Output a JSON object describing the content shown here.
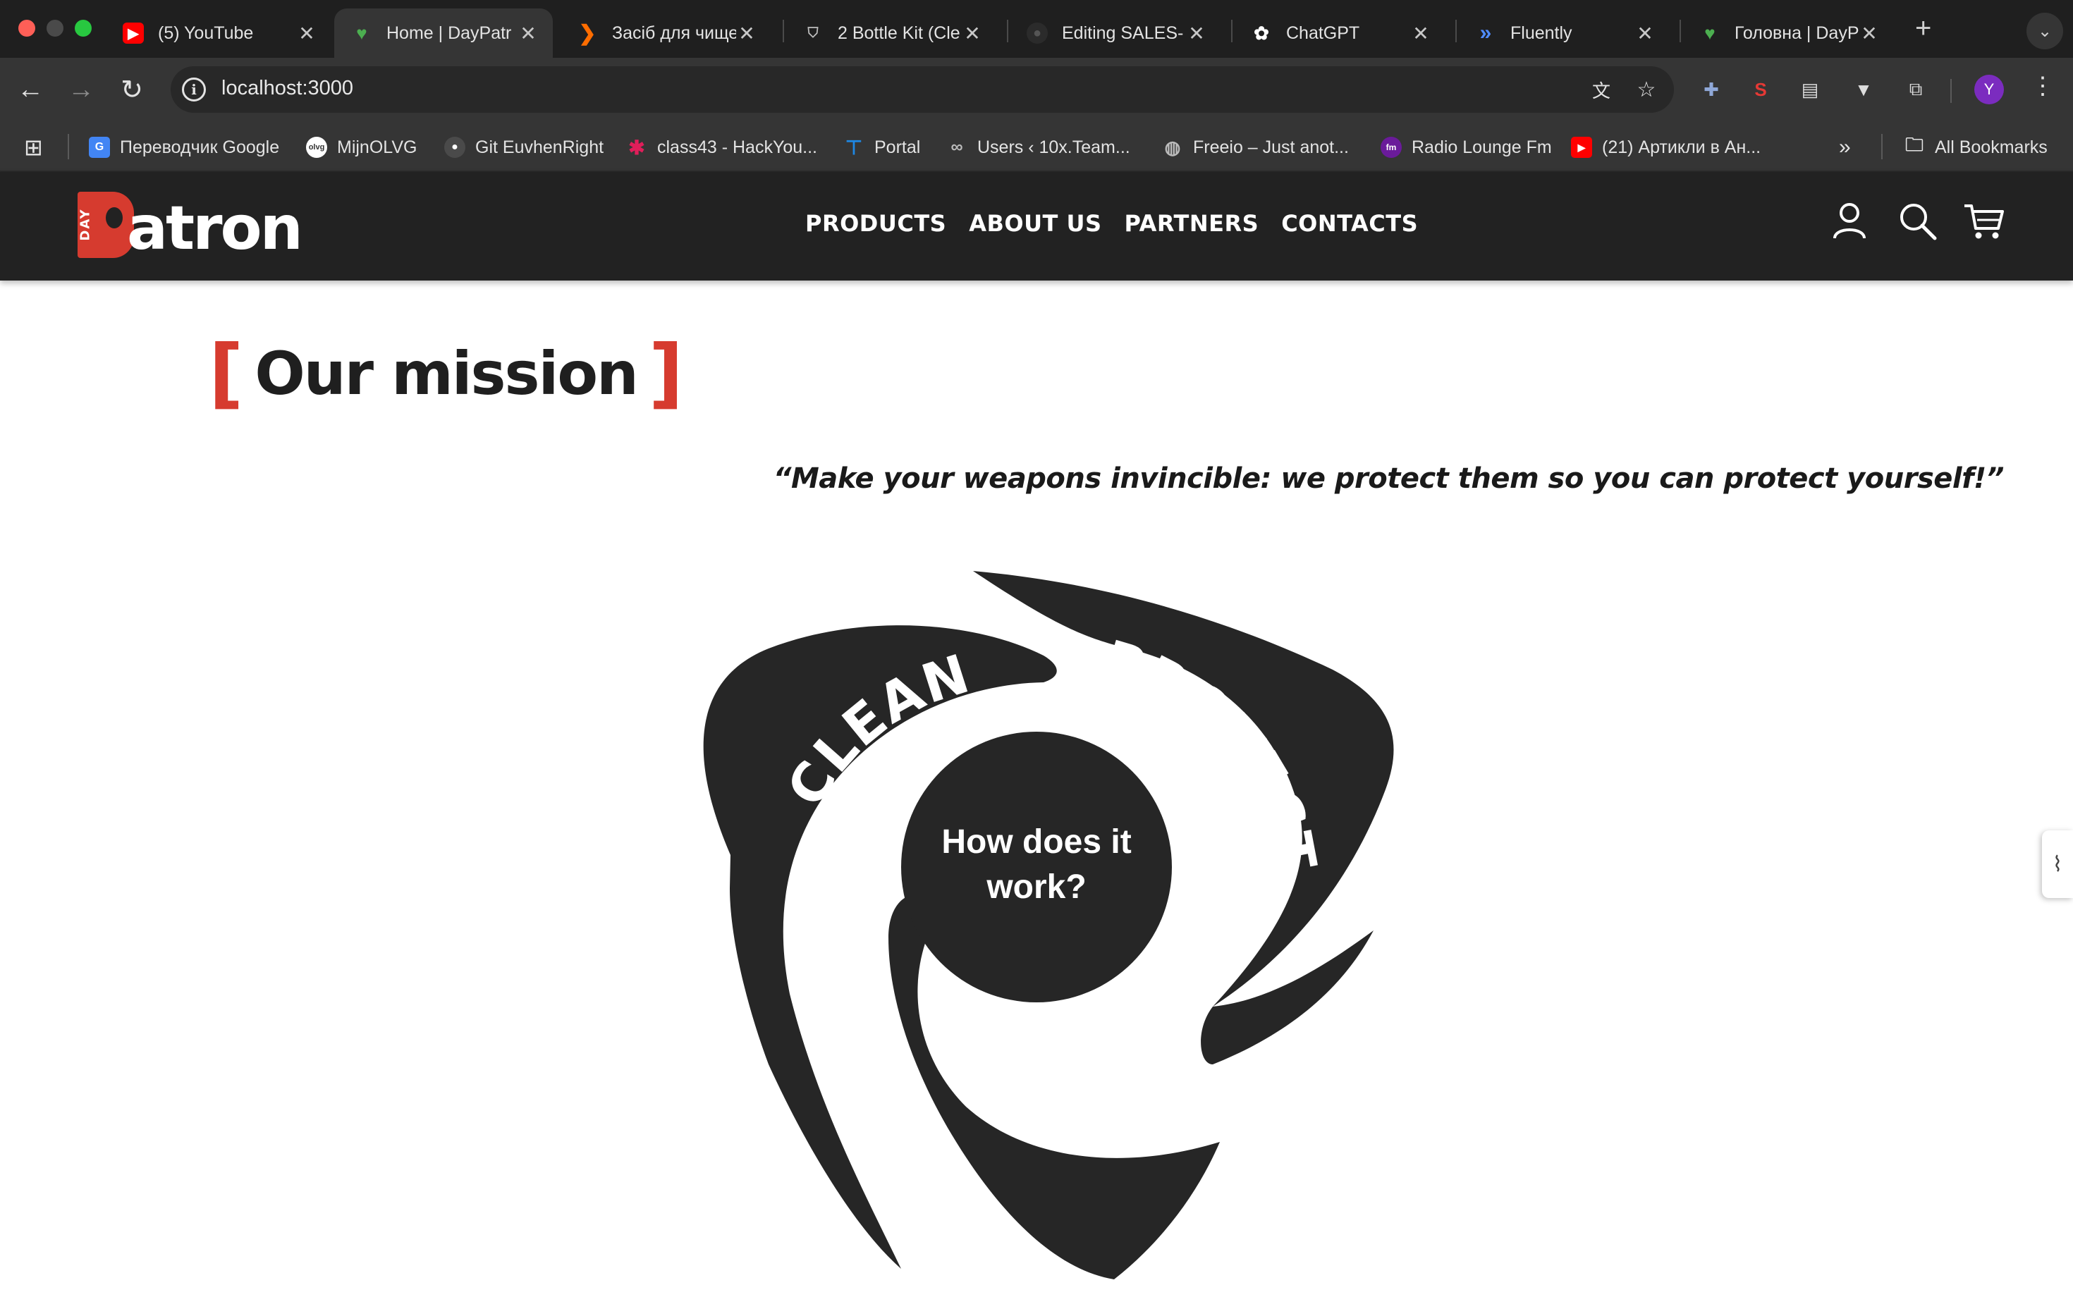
{
  "browser": {
    "tabs": [
      {
        "title": "(5) YouTube",
        "icon": "youtube-icon",
        "icon_color": "#ff0000"
      },
      {
        "title": "Home | DayPatr",
        "icon": "daypatron-icon",
        "icon_color": "#4caf50"
      },
      {
        "title": "Засіб для чище",
        "icon": "arrow-logo-icon",
        "icon_color": "#ff6d00"
      },
      {
        "title": "2 Bottle Kit (Cle",
        "icon": "shield-icon",
        "icon_color": "#9e9e9e"
      },
      {
        "title": "Editing SALES-",
        "icon": "github-icon",
        "icon_color": "#2b2b2b"
      },
      {
        "title": "ChatGPT",
        "icon": "chatgpt-icon",
        "icon_color": "#ffffff"
      },
      {
        "title": "Fluently",
        "icon": "fluently-icon",
        "icon_color": "#4f8cff"
      },
      {
        "title": "Головна | DayP",
        "icon": "daypatron-icon",
        "icon_color": "#4caf50"
      }
    ],
    "url": "localhost:3000",
    "profile_initial": "Y",
    "bookmarks": [
      {
        "label": "Переводчик Google",
        "icon": "google-translate-icon",
        "icon_color": "#4285f4"
      },
      {
        "label": "MijnOLVG",
        "icon": "olvg-icon",
        "icon_color": "#ffffff"
      },
      {
        "label": "Git EuvhenRight",
        "icon": "github-icon",
        "icon_color": "#3a3a3a"
      },
      {
        "label": "class43 - HackYou...",
        "icon": "slack-icon",
        "icon_color": "#e01e5a"
      },
      {
        "label": "Portal",
        "icon": "portal-icon",
        "icon_color": "#1e88e5"
      },
      {
        "label": "Users ‹ 10x.Team...",
        "icon": "infinity-icon",
        "icon_color": "#555555"
      },
      {
        "label": "Freeio – Just anot...",
        "icon": "globe-icon",
        "icon_color": "#9e9e9e"
      },
      {
        "label": "Radio Lounge Fm",
        "icon": "radio-icon",
        "icon_color": "#6a1b9a"
      },
      {
        "label": "(21) Артикли в Ан...",
        "icon": "youtube-icon",
        "icon_color": "#ff0000"
      }
    ],
    "all_bookmarks": "All Bookmarks"
  },
  "site": {
    "logo": {
      "day": "DAY",
      "name": "atron",
      "accent": "#d63b2f"
    },
    "nav": [
      "PRODUCTS",
      "ABOUT US",
      "PARTNERS",
      "CONTACTS"
    ],
    "icons": [
      "user-icon",
      "search-icon",
      "cart-icon"
    ],
    "header_bg": "#222222"
  },
  "content": {
    "mission_title": "Our mission",
    "quote": "“Make your weapons invincible: we protect them so you can protect yourself!”",
    "diagram": {
      "segments": [
        "CLEAN",
        "PROTECT",
        "LUBE"
      ],
      "center_line1": "How does it",
      "center_line2": "work?",
      "color": "#262626"
    }
  }
}
